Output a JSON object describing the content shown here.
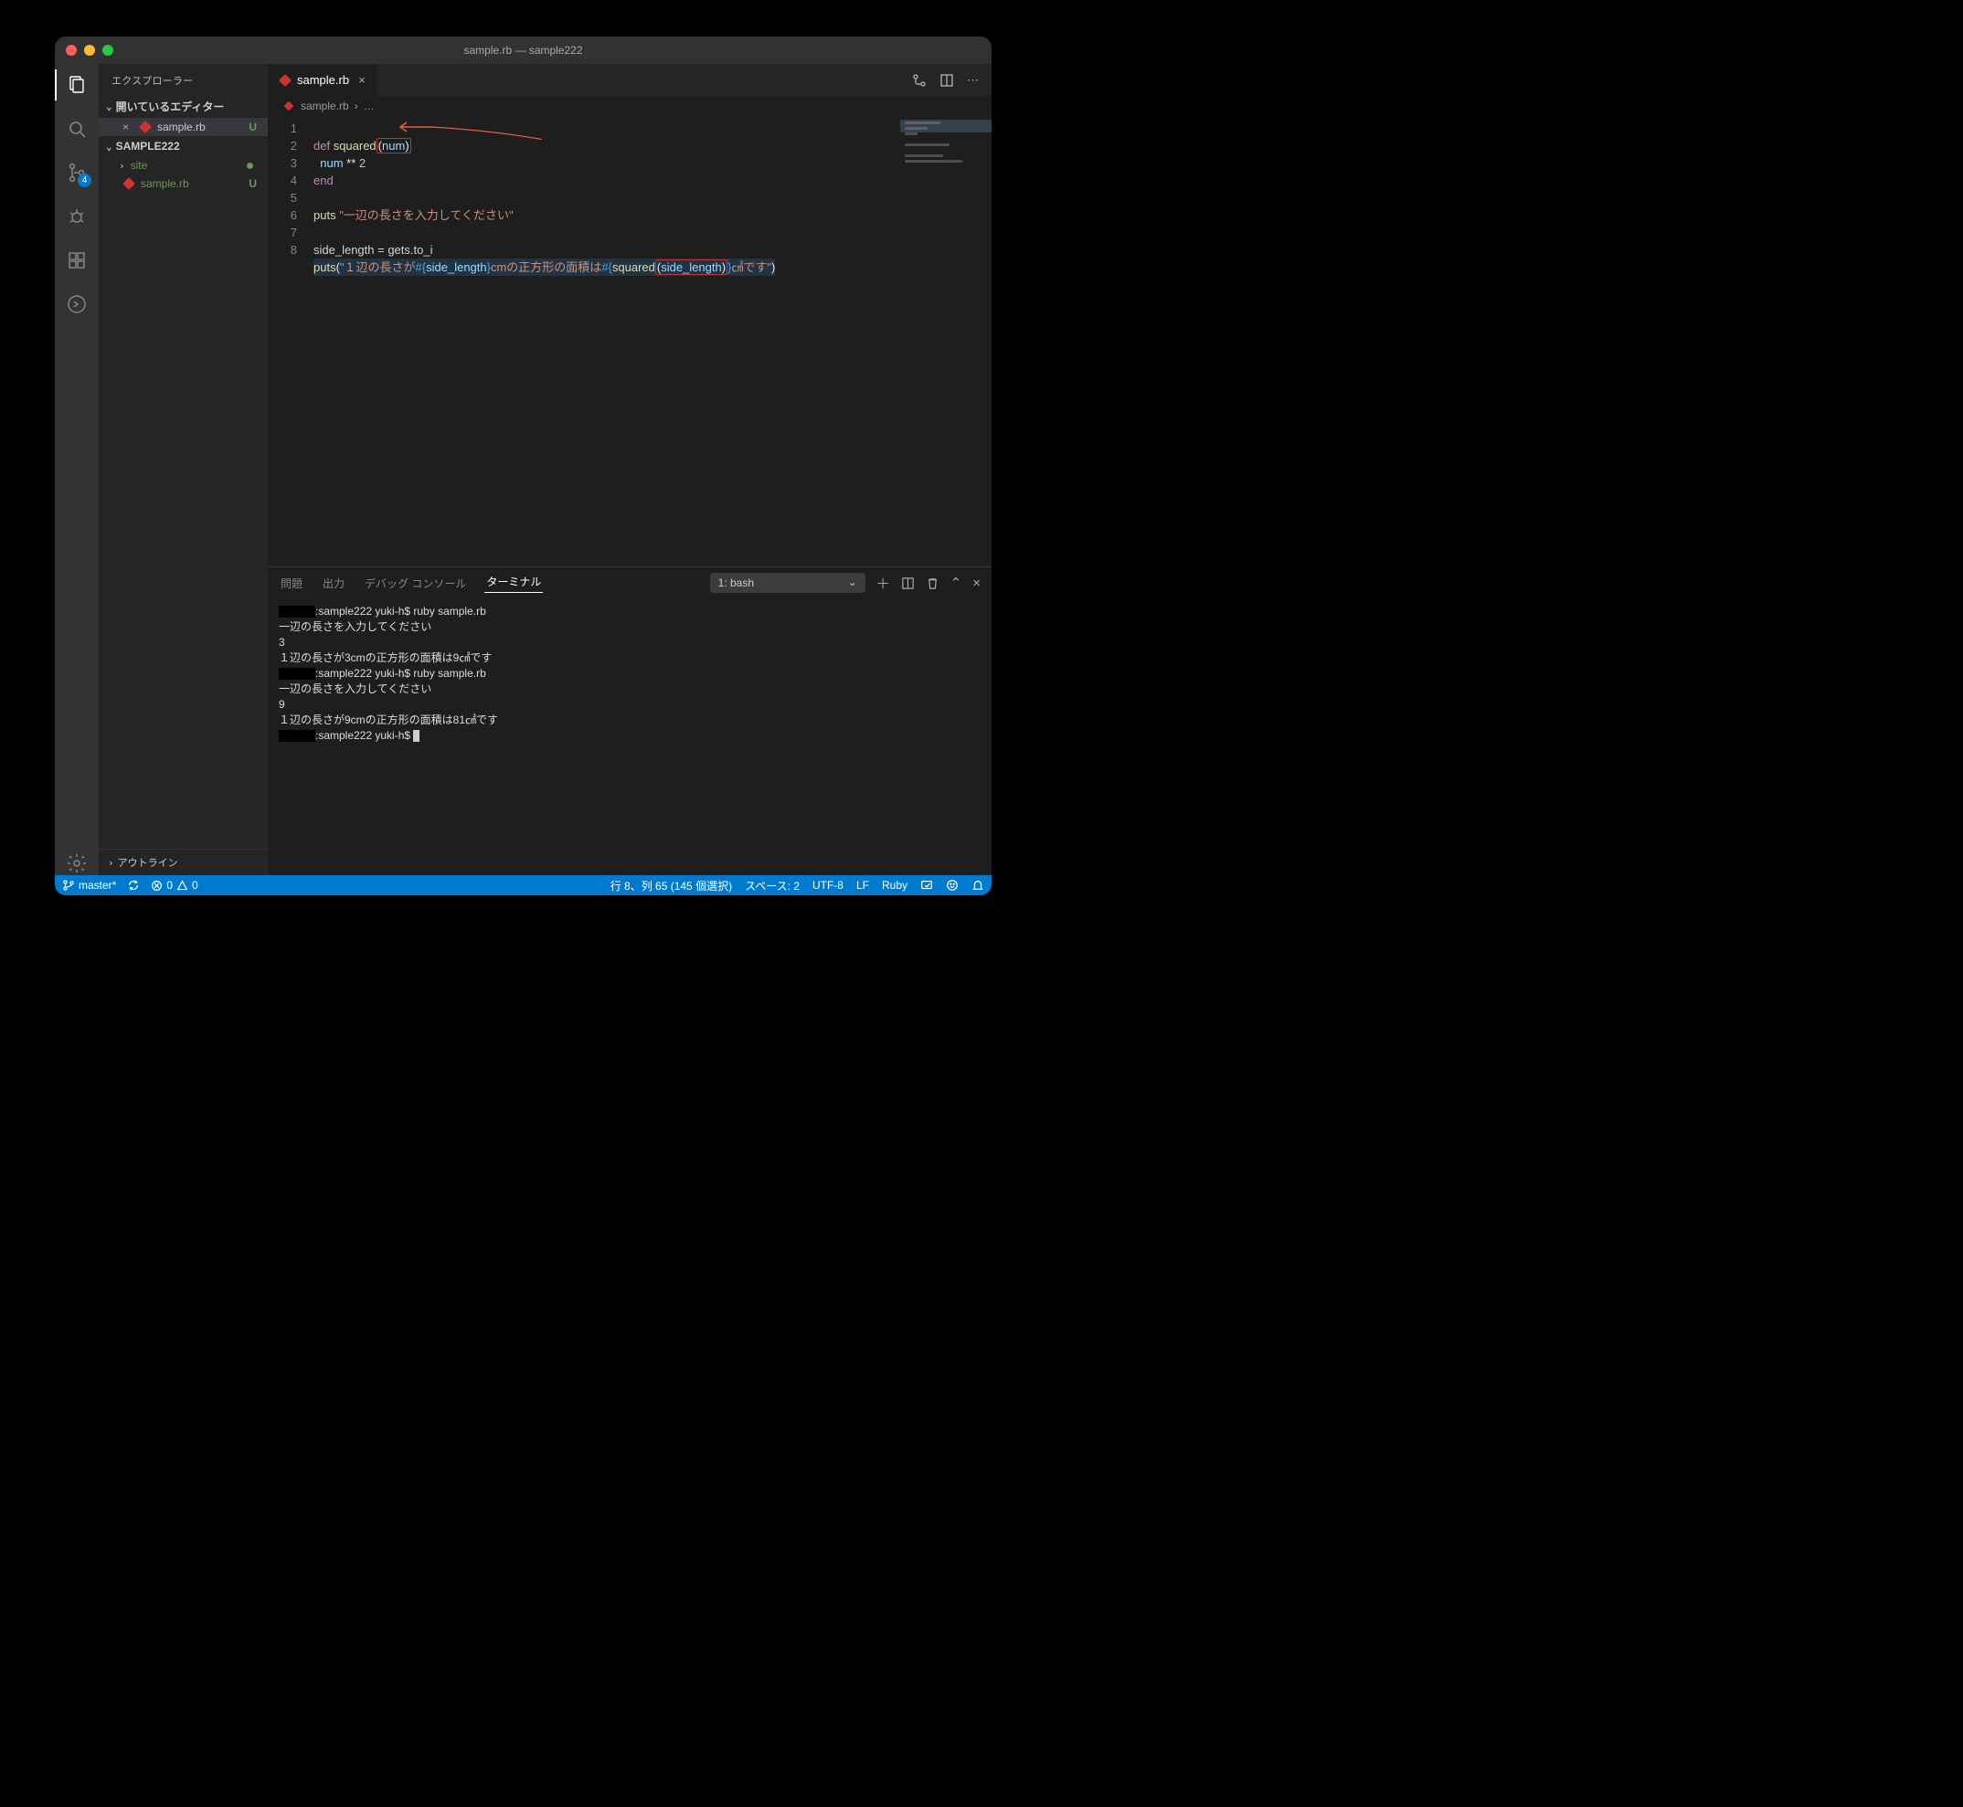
{
  "titlebar": {
    "title": "sample.rb — sample222"
  },
  "activity": {
    "scm_badge": "4"
  },
  "sidebar": {
    "header": "エクスプローラー",
    "open_editors_label": "開いているエディター",
    "open_file": "sample.rb",
    "open_file_status": "U",
    "workspace": "SAMPLE222",
    "folder": "site",
    "file": "sample.rb",
    "file_status": "U",
    "outline": "アウトライン"
  },
  "tabs": {
    "open_tab": "sample.rb"
  },
  "breadcrumb": {
    "file": "sample.rb",
    "rest": "…"
  },
  "editor": {
    "line_numbers": [
      "1",
      "2",
      "3",
      "4",
      "5",
      "6",
      "7",
      "8"
    ],
    "l1_def": "def ",
    "l1_fn": "squared",
    "l1_num": "num",
    "l2_indent": "  ",
    "l2_var": "num",
    "l2_op": " ** ",
    "l2_n": "2",
    "l3": "end",
    "l5_puts": "puts ",
    "l5_str": "\"一辺の長さを入力してください\"",
    "l7": "side_length = gets.to_i",
    "l8_puts": "puts",
    "l8_s1": "\"１辺の長さが",
    "l8_i1o": "#{",
    "l8_i1v": "side_length",
    "l8_i1c": "}",
    "l8_s2": "cmの正方形の面積は",
    "l8_i2o": "#{",
    "l8_i2f": "squared",
    "l8_i2v": "side_length",
    "l8_i2c": "}",
    "l8_s3": "㎠です\""
  },
  "panel": {
    "tabs": {
      "problems": "問題",
      "output": "出力",
      "debug": "デバッグ コンソール",
      "terminal": "ターミナル"
    },
    "term_selector": "1: bash",
    "terminal_lines": [
      {
        "blackout": 40,
        "text": ":sample222 yuki-h$ ruby sample.rb"
      },
      {
        "text": "一辺の長さを入力してください"
      },
      {
        "text": "3"
      },
      {
        "text": "１辺の長さが3cmの正方形の面積は9㎠です"
      },
      {
        "blackout": 40,
        "text": ":sample222 yuki-h$ ruby sample.rb"
      },
      {
        "text": "一辺の長さを入力してください"
      },
      {
        "text": "9"
      },
      {
        "text": "１辺の長さが9cmの正方形の面積は81㎠です"
      },
      {
        "blackout": 40,
        "text": ":sample222 yuki-h$ ",
        "cursor": true
      }
    ]
  },
  "status": {
    "branch": "master*",
    "errors": "0",
    "warnings": "0",
    "cursor": "行 8、列 65 (145 個選択)",
    "spaces": "スペース: 2",
    "encoding": "UTF-8",
    "eol": "LF",
    "lang": "Ruby"
  }
}
